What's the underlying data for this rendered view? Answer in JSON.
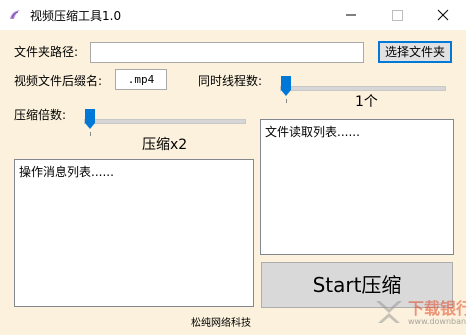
{
  "window": {
    "title": "视频压缩工具1.0"
  },
  "form": {
    "folder_path_label": "文件夹路径:",
    "folder_path_value": "",
    "choose_folder_button": "选择文件夹",
    "suffix_label": "视频文件后缀名:",
    "suffix_value": ".mp4",
    "threads_label": "同时线程数:",
    "threads_value": "1个",
    "threads_slider_level": 0,
    "ratio_label": "压缩倍数:",
    "ratio_value": "压缩x2",
    "ratio_slider_level": 0
  },
  "lists": {
    "file_list_header": "文件读取列表......",
    "message_list_header": "操作消息列表......"
  },
  "actions": {
    "start_button": "Start压缩"
  },
  "footer": {
    "company": "松纯网络科技"
  },
  "watermark": {
    "brand": "下载银行",
    "url": "www.downbank.cn"
  },
  "colors": {
    "background": "#fbf1dc",
    "accent": "#0078d7",
    "watermark": "#e04a2a"
  },
  "icons": {
    "app": "app-icon",
    "minimize": "minimize-icon",
    "maximize": "maximize-icon",
    "close": "close-icon"
  }
}
